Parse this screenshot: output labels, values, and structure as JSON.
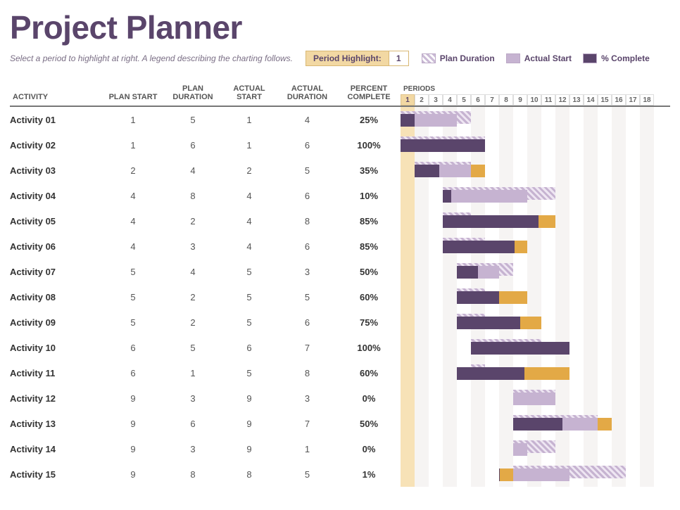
{
  "title": "Project Planner",
  "instructions": "Select a period to highlight at right.  A legend describing the charting follows.",
  "period_highlight_label": "Period Highlight:",
  "period_highlight_value": "1",
  "legend": {
    "plan": "Plan Duration",
    "actual": "Actual Start",
    "complete": "% Complete"
  },
  "columns": {
    "activity": "ACTIVITY",
    "plan_start": "PLAN START",
    "plan_duration": "PLAN DURATION",
    "actual_start": "ACTUAL START",
    "actual_duration": "ACTUAL DURATION",
    "percent_complete": "PERCENT COMPLETE",
    "periods": "PERIODS"
  },
  "periods": [
    1,
    2,
    3,
    4,
    5,
    6,
    7,
    8,
    9,
    10,
    11,
    12,
    13,
    14,
    15,
    16,
    17,
    18
  ],
  "highlight_period": 1,
  "activities": [
    {
      "name": "Activity 01",
      "ps": 1,
      "pd": 5,
      "as": 1,
      "ad": 4,
      "pc": "25%",
      "pcv": 0.25
    },
    {
      "name": "Activity 02",
      "ps": 1,
      "pd": 6,
      "as": 1,
      "ad": 6,
      "pc": "100%",
      "pcv": 1.0
    },
    {
      "name": "Activity 03",
      "ps": 2,
      "pd": 4,
      "as": 2,
      "ad": 5,
      "pc": "35%",
      "pcv": 0.35
    },
    {
      "name": "Activity 04",
      "ps": 4,
      "pd": 8,
      "as": 4,
      "ad": 6,
      "pc": "10%",
      "pcv": 0.1
    },
    {
      "name": "Activity 05",
      "ps": 4,
      "pd": 2,
      "as": 4,
      "ad": 8,
      "pc": "85%",
      "pcv": 0.85
    },
    {
      "name": "Activity 06",
      "ps": 4,
      "pd": 3,
      "as": 4,
      "ad": 6,
      "pc": "85%",
      "pcv": 0.85
    },
    {
      "name": "Activity 07",
      "ps": 5,
      "pd": 4,
      "as": 5,
      "ad": 3,
      "pc": "50%",
      "pcv": 0.5
    },
    {
      "name": "Activity 08",
      "ps": 5,
      "pd": 2,
      "as": 5,
      "ad": 5,
      "pc": "60%",
      "pcv": 0.6
    },
    {
      "name": "Activity 09",
      "ps": 5,
      "pd": 2,
      "as": 5,
      "ad": 6,
      "pc": "75%",
      "pcv": 0.75
    },
    {
      "name": "Activity 10",
      "ps": 6,
      "pd": 5,
      "as": 6,
      "ad": 7,
      "pc": "100%",
      "pcv": 1.0
    },
    {
      "name": "Activity 11",
      "ps": 6,
      "pd": 1,
      "as": 5,
      "ad": 8,
      "pc": "60%",
      "pcv": 0.6
    },
    {
      "name": "Activity 12",
      "ps": 9,
      "pd": 3,
      "as": 9,
      "ad": 3,
      "pc": "0%",
      "pcv": 0.0
    },
    {
      "name": "Activity 13",
      "ps": 9,
      "pd": 6,
      "as": 9,
      "ad": 7,
      "pc": "50%",
      "pcv": 0.5
    },
    {
      "name": "Activity 14",
      "ps": 9,
      "pd": 3,
      "as": 9,
      "ad": 1,
      "pc": "0%",
      "pcv": 0.0
    },
    {
      "name": "Activity 15",
      "ps": 9,
      "pd": 8,
      "as": 8,
      "ad": 5,
      "pc": "1%",
      "pcv": 0.01
    }
  ],
  "chart_data": {
    "type": "bar",
    "title": "Project Planner Gantt",
    "xlabel": "Periods",
    "ylabel": "Activity",
    "xlim": [
      1,
      18
    ],
    "categories": [
      "Activity 01",
      "Activity 02",
      "Activity 03",
      "Activity 04",
      "Activity 05",
      "Activity 06",
      "Activity 07",
      "Activity 08",
      "Activity 09",
      "Activity 10",
      "Activity 11",
      "Activity 12",
      "Activity 13",
      "Activity 14",
      "Activity 15"
    ],
    "series": [
      {
        "name": "Plan Start",
        "values": [
          1,
          1,
          2,
          4,
          4,
          4,
          5,
          5,
          5,
          6,
          6,
          9,
          9,
          9,
          9
        ]
      },
      {
        "name": "Plan Duration",
        "values": [
          5,
          6,
          4,
          8,
          2,
          3,
          4,
          2,
          2,
          5,
          1,
          3,
          6,
          3,
          8
        ]
      },
      {
        "name": "Actual Start",
        "values": [
          1,
          1,
          2,
          4,
          4,
          4,
          5,
          5,
          5,
          6,
          5,
          9,
          9,
          9,
          8
        ]
      },
      {
        "name": "Actual Duration",
        "values": [
          4,
          6,
          5,
          6,
          8,
          6,
          3,
          5,
          6,
          7,
          8,
          3,
          7,
          1,
          5
        ]
      },
      {
        "name": "Percent Complete",
        "values": [
          25,
          100,
          35,
          10,
          85,
          85,
          50,
          60,
          75,
          100,
          60,
          0,
          50,
          0,
          1
        ]
      }
    ]
  }
}
